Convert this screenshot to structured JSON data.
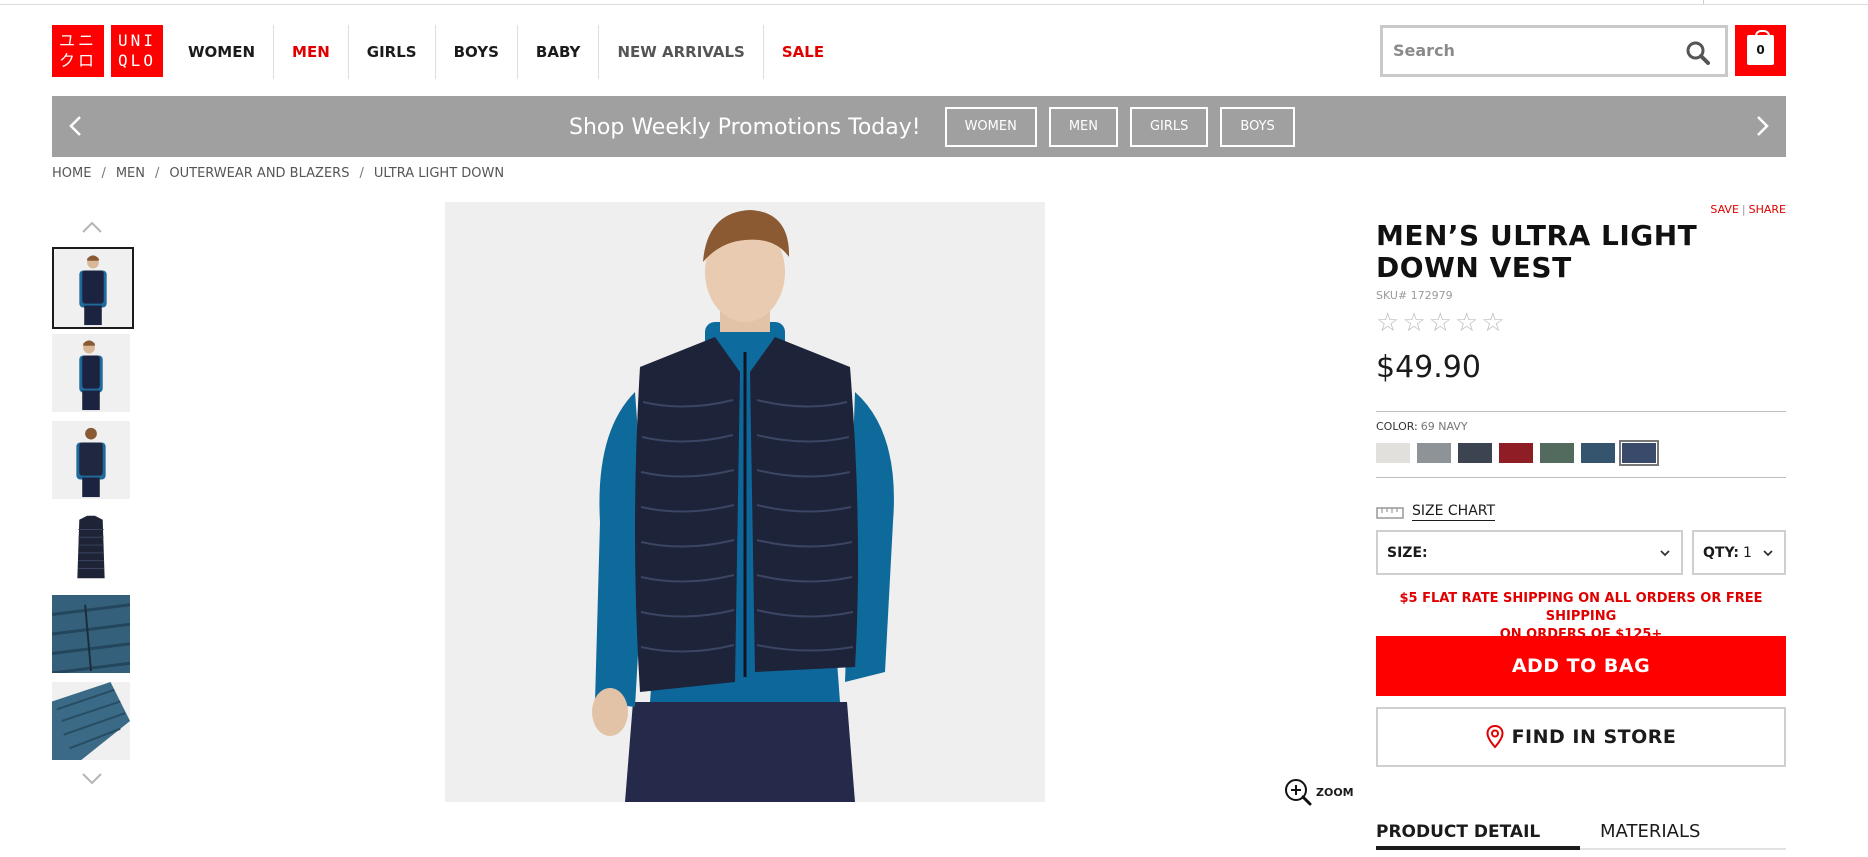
{
  "header": {
    "logo_lines_1": [
      "ユニ",
      "クロ"
    ],
    "logo_lines_2": [
      "UNI",
      "QLO"
    ],
    "nav": [
      {
        "label": "WOMEN",
        "style": "black"
      },
      {
        "label": "MEN",
        "style": "red"
      },
      {
        "label": "GIRLS",
        "style": "black"
      },
      {
        "label": "BOYS",
        "style": "black"
      },
      {
        "label": "BABY",
        "style": "black"
      },
      {
        "label": "NEW ARRIVALS",
        "style": "gray"
      },
      {
        "label": "SALE",
        "style": "red"
      }
    ],
    "search_placeholder": "Search",
    "bag_count": "0"
  },
  "promo": {
    "title": "Shop Weekly Promotions Today!",
    "buttons": [
      "WOMEN",
      "MEN",
      "GIRLS",
      "BOYS"
    ]
  },
  "breadcrumb": [
    "HOME",
    "MEN",
    "OUTERWEAR AND BLAZERS",
    "ULTRA LIGHT DOWN"
  ],
  "product": {
    "save_label": "SAVE",
    "share_label": "SHARE",
    "title": "MEN’S ULTRA LIGHT DOWN VEST",
    "sku": "SKU# 172979",
    "rating": 0,
    "rating_max": 5,
    "price": "$49.90",
    "color_label": "COLOR:",
    "color_value": "69 NAVY",
    "swatches": [
      "#e2e0dc",
      "#8e9397",
      "#3d4451",
      "#8f1d26",
      "#536a5e",
      "#35546d",
      "#3a4a6b"
    ],
    "selected_swatch": 6,
    "size_chart_label": "SIZE CHART",
    "size_label": "SIZE:",
    "qty_label": "QTY:",
    "qty_value": "1",
    "shipping_line1": "$5 FLAT RATE SHIPPING ON ALL ORDERS OR FREE SHIPPING",
    "shipping_line2": "ON ORDERS OF $125+",
    "add_to_bag": "ADD TO BAG",
    "find_in_store": "FIND IN STORE",
    "zoom_label": "ZOOM",
    "tabs": [
      "PRODUCT DETAIL",
      "MATERIALS"
    ]
  },
  "colors": {
    "brand_red": "#ff0000",
    "promo_gray": "#a0a0a0"
  }
}
